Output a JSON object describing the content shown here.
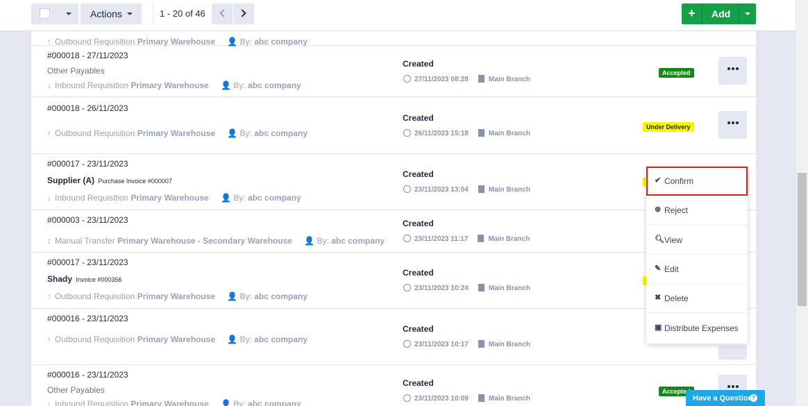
{
  "toolbar": {
    "actions_label": "Actions",
    "page_count": "1 - 20 of 46",
    "add_label": "Add",
    "add_plus": "+"
  },
  "top_partial_row": {
    "type": "Outbound Requisition",
    "warehouse": "Primary Warehouse",
    "by_label": "By:",
    "by_name": "abc company"
  },
  "rows": [
    {
      "ref": "#000018 - 27/11/2023",
      "sub": "Other Payables",
      "type": "Inbound Requisition",
      "warehouse": "Primary Warehouse",
      "by_label": "By:",
      "by_name": "abc company",
      "status": "Created",
      "datetime": "27/11/2023 08:28",
      "branch": "Main Branch",
      "badge": "Accepted",
      "badge_color": "#138a14"
    },
    {
      "ref": "#000018 - 26/11/2023",
      "type": "Outbound Requisition",
      "warehouse": "Primary Warehouse",
      "by_label": "By:",
      "by_name": "abc company",
      "status": "Created",
      "datetime": "26/11/2023 15:18",
      "branch": "Main Branch",
      "badge": "Under Delivery",
      "badge_color": "#f8f600"
    },
    {
      "ref": "#000017 - 23/11/2023",
      "party_name": "Supplier (A)",
      "party_doc": "Purchase Invoice #000007",
      "type": "Inbound Requisition",
      "warehouse": "Primary Warehouse",
      "by_label": "By:",
      "by_name": "abc company",
      "status": "Created",
      "datetime": "23/11/2023 13:04",
      "branch": "Main Branch"
    },
    {
      "ref": "#000003 - 23/11/2023",
      "type": "Manual Transfer",
      "warehouse": "Primary Warehouse - Secondary Warehouse",
      "by_label": "By:",
      "by_name": "abc company",
      "status": "Created",
      "datetime": "23/11/2023 11:17",
      "branch": "Main Branch"
    },
    {
      "ref": "#000017 - 23/11/2023",
      "party_name": "Shady",
      "party_doc": "Invoice #000356",
      "type": "Outbound Requisition",
      "warehouse": "Primary Warehouse",
      "by_label": "By:",
      "by_name": "abc company",
      "status": "Created",
      "datetime": "23/11/2023 10:24",
      "branch": "Main Branch"
    },
    {
      "ref": "#000016 - 23/11/2023",
      "type": "Outbound Requisition",
      "warehouse": "Primary Warehouse",
      "by_label": "By:",
      "by_name": "abc company",
      "status": "Created",
      "datetime": "23/11/2023 10:17",
      "branch": "Main Branch"
    },
    {
      "ref": "#000016 - 23/11/2023",
      "sub": "Other Payables",
      "type": "Inbound Requisition",
      "warehouse": "Primary Warehouse",
      "by_label": "By:",
      "by_name": "abc company",
      "status": "Created",
      "datetime": "23/11/2023 10:09",
      "branch": "Main Branch",
      "badge": "Accepted",
      "badge_color": "#138a14"
    }
  ],
  "menu": {
    "items": [
      {
        "label": "Confirm",
        "icon": "check-icon"
      },
      {
        "label": "Reject",
        "icon": "times-circle-icon"
      },
      {
        "label": "View",
        "icon": "search-icon"
      },
      {
        "label": "Edit",
        "icon": "pencil-icon"
      },
      {
        "label": "Delete",
        "icon": "times-icon"
      },
      {
        "label": "Distribute Expenses",
        "icon": "money-icon"
      }
    ]
  },
  "help": {
    "label": "Have a Question",
    "icon_glyph": "?"
  }
}
